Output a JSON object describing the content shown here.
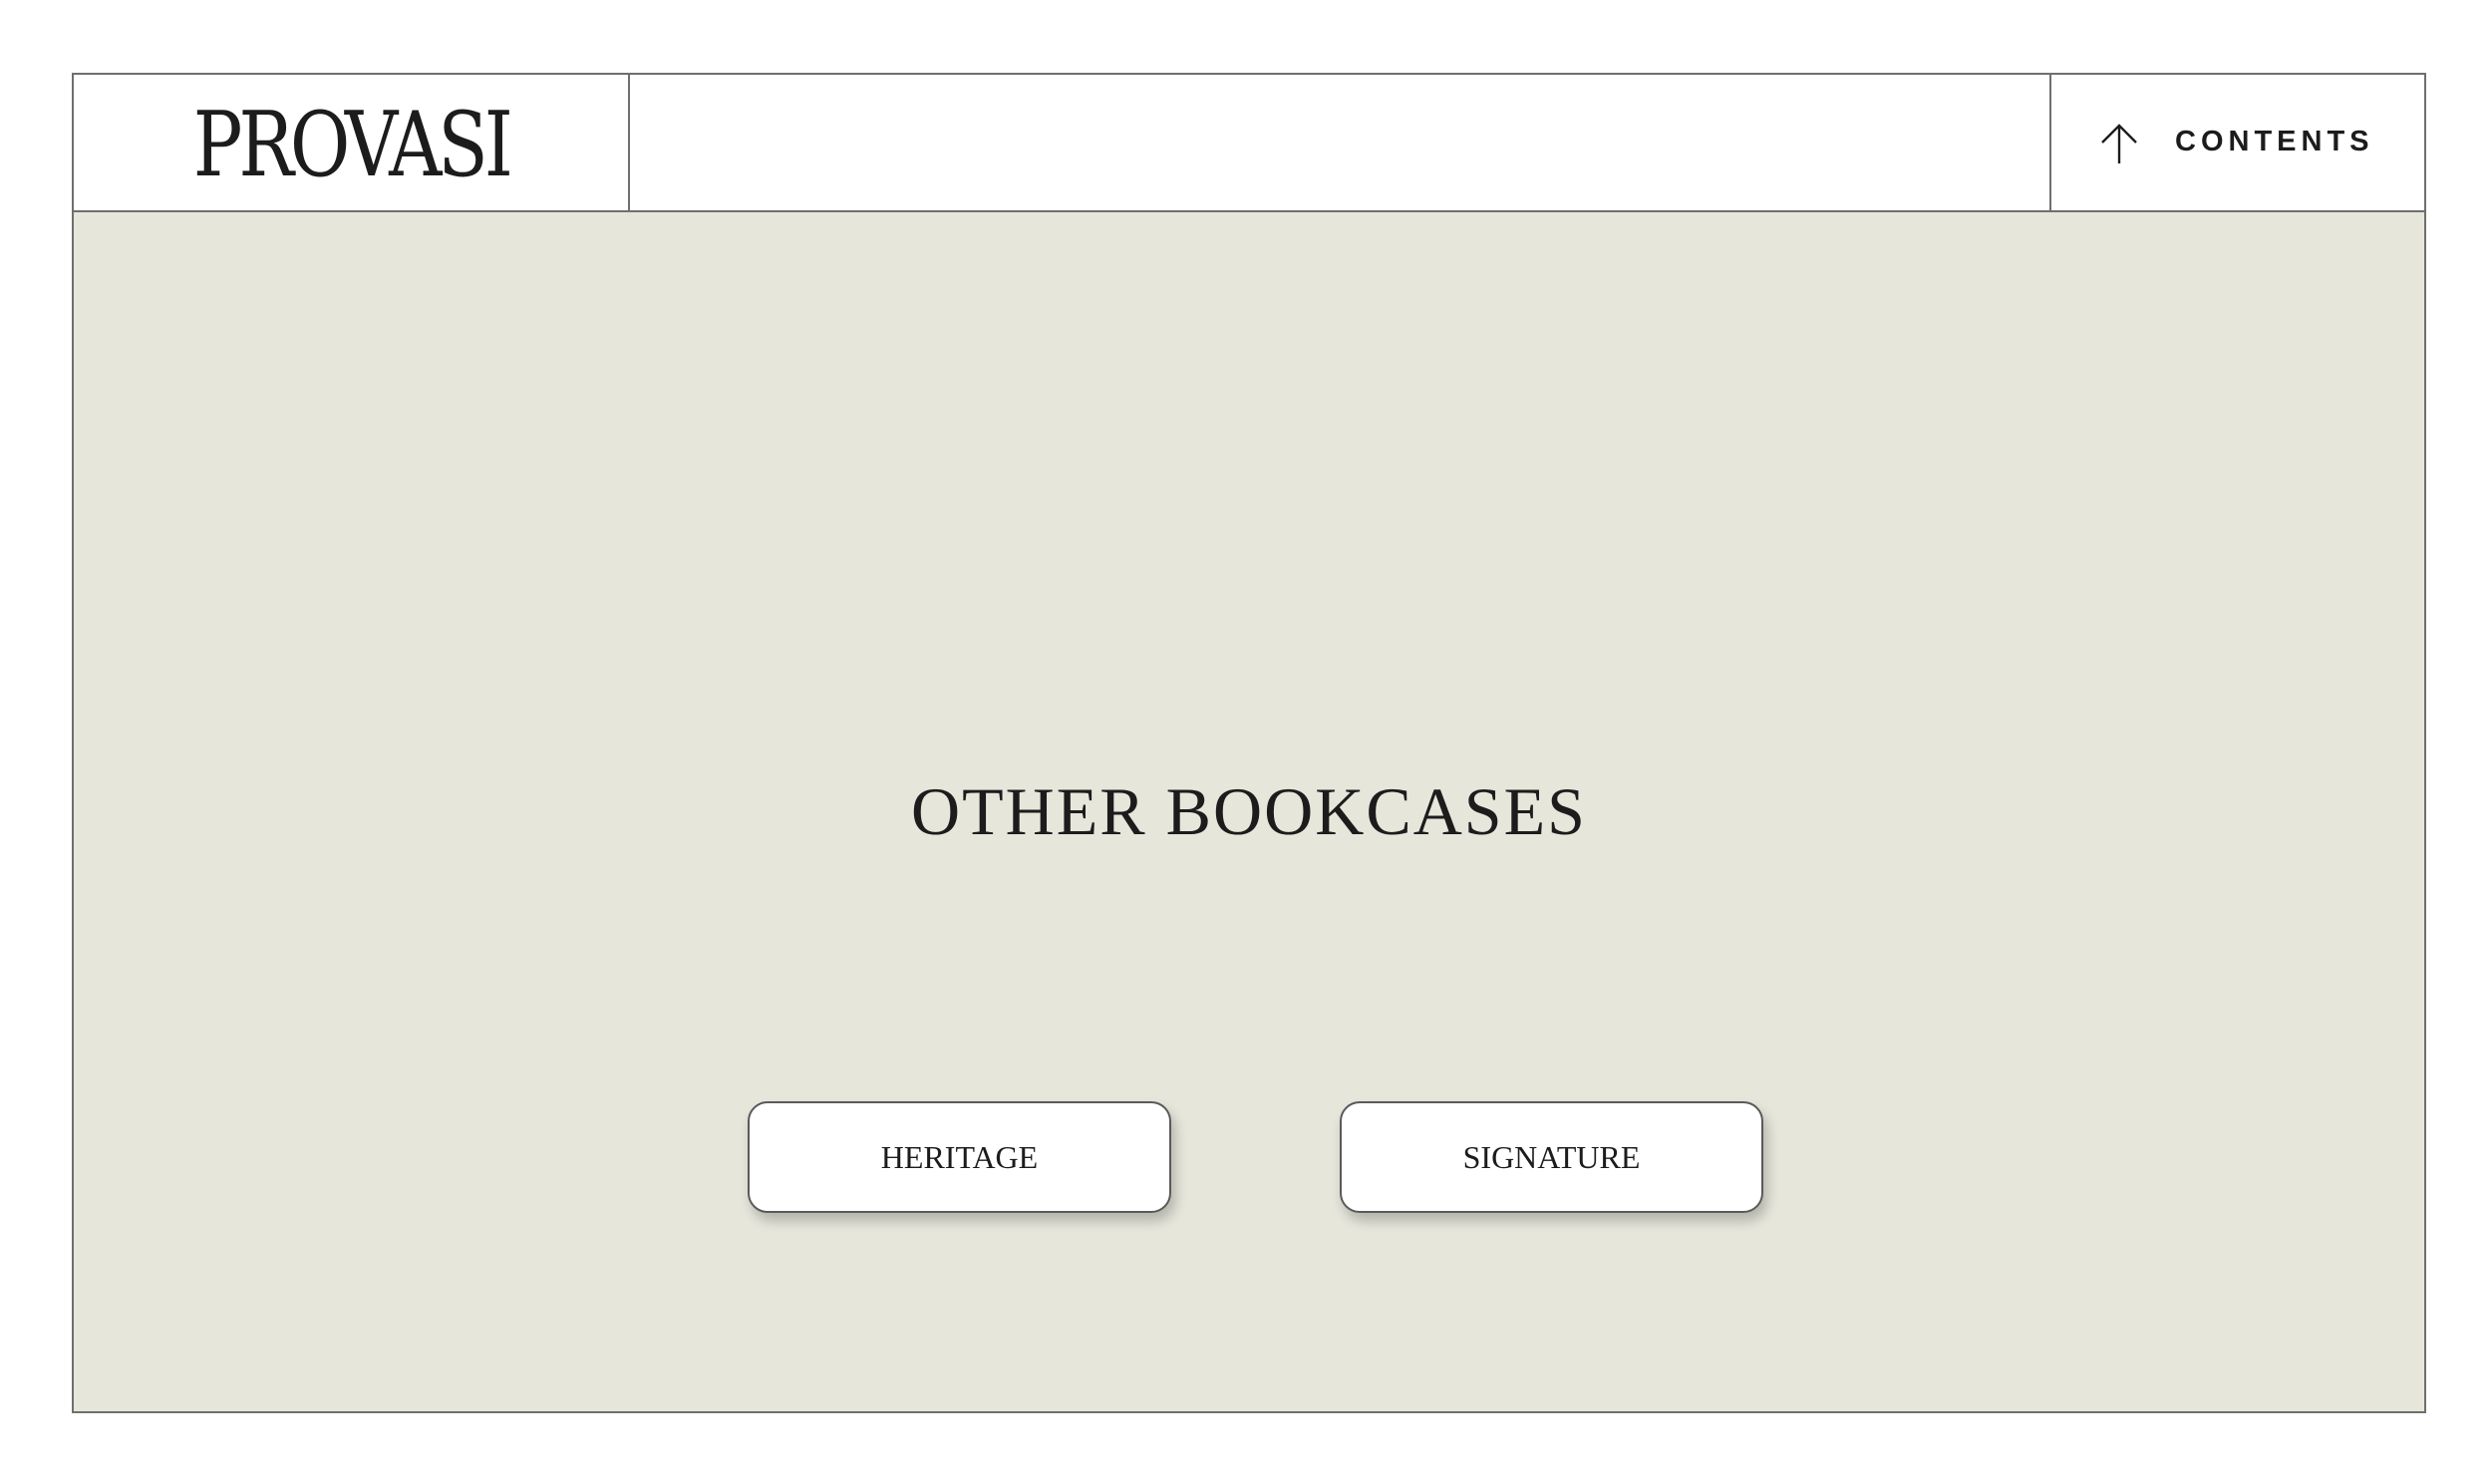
{
  "header": {
    "logo_text": "PROVASI",
    "contents_label": "CONTENTS",
    "contents_icon": "arrow-up-icon"
  },
  "main": {
    "headline": "OTHER BOOKCASES",
    "buttons": [
      {
        "label": "HERITAGE"
      },
      {
        "label": "SIGNATURE"
      }
    ]
  },
  "colors": {
    "background_panel": "#e6e6db",
    "header_background": "#ffffff",
    "border": "#6f6f6f",
    "text": "#1c1c1c"
  }
}
